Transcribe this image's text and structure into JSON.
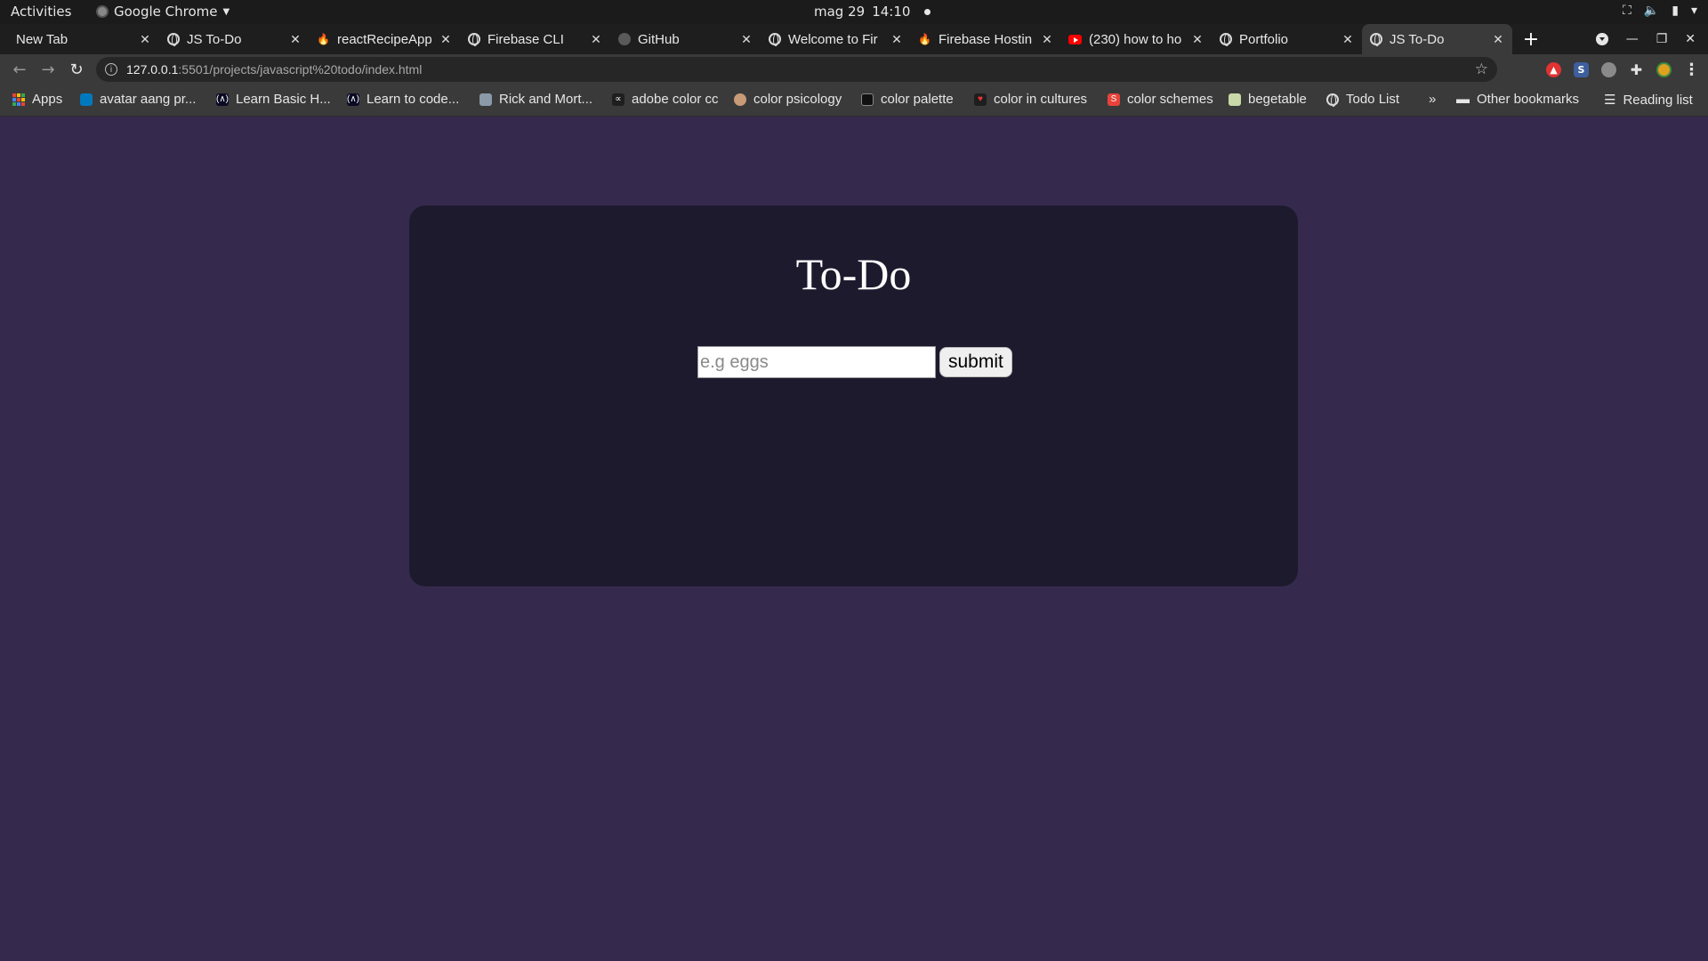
{
  "os_topbar": {
    "activities": "Activities",
    "app_name": "Google Chrome",
    "date": "mag 29",
    "time": "14:10"
  },
  "tabs": [
    {
      "title": "New Tab",
      "icon": "none",
      "active": false
    },
    {
      "title": "JS To-Do",
      "icon": "globe-icon",
      "active": false
    },
    {
      "title": "reactRecipeApp",
      "icon": "firebase-icon",
      "active": false
    },
    {
      "title": "Firebase CLI",
      "icon": "globe-icon",
      "active": false
    },
    {
      "title": "GitHub",
      "icon": "github-icon",
      "active": false
    },
    {
      "title": "Welcome to Fir",
      "icon": "globe-icon",
      "active": false
    },
    {
      "title": "Firebase Hostin",
      "icon": "firebase-icon",
      "active": false
    },
    {
      "title": "(230) how to ho",
      "icon": "youtube-icon",
      "active": false
    },
    {
      "title": "Portfolio",
      "icon": "globe-icon",
      "active": false
    },
    {
      "title": "JS To-Do",
      "icon": "globe-icon",
      "active": true
    }
  ],
  "omnibox": {
    "host": "127.0.0.1",
    "path": ":5501/projects/javascript%20todo/index.html"
  },
  "bookmarks": {
    "items": [
      {
        "label": "Apps",
        "icon": "apps-grid-icon"
      },
      {
        "label": "avatar aang pr...",
        "icon": "trello-icon"
      },
      {
        "label": "Learn Basic H...",
        "icon": "freecodecamp-icon"
      },
      {
        "label": "Learn to code...",
        "icon": "freecodecamp-icon"
      },
      {
        "label": "Rick and Mort...",
        "icon": "image-icon"
      },
      {
        "label": "adobe color cc",
        "icon": "adobe-color-icon"
      },
      {
        "label": "color psicology",
        "icon": "face-icon"
      },
      {
        "label": "color palette",
        "icon": "site-icon"
      },
      {
        "label": "color in cultures",
        "icon": "site-red-icon"
      },
      {
        "label": "color schemes",
        "icon": "s-red-icon"
      },
      {
        "label": "begetable",
        "icon": "folder-image-icon"
      },
      {
        "label": "Todo List",
        "icon": "globe-icon"
      }
    ],
    "overflow": "»",
    "other": "Other bookmarks",
    "reading_list": "Reading list"
  },
  "app": {
    "title": "To-Do",
    "input_placeholder": "e.g eggs",
    "input_value": "",
    "submit_label": "submit"
  },
  "colors": {
    "page_bg": "#352a4d",
    "card_bg": "#1e1a2e"
  }
}
